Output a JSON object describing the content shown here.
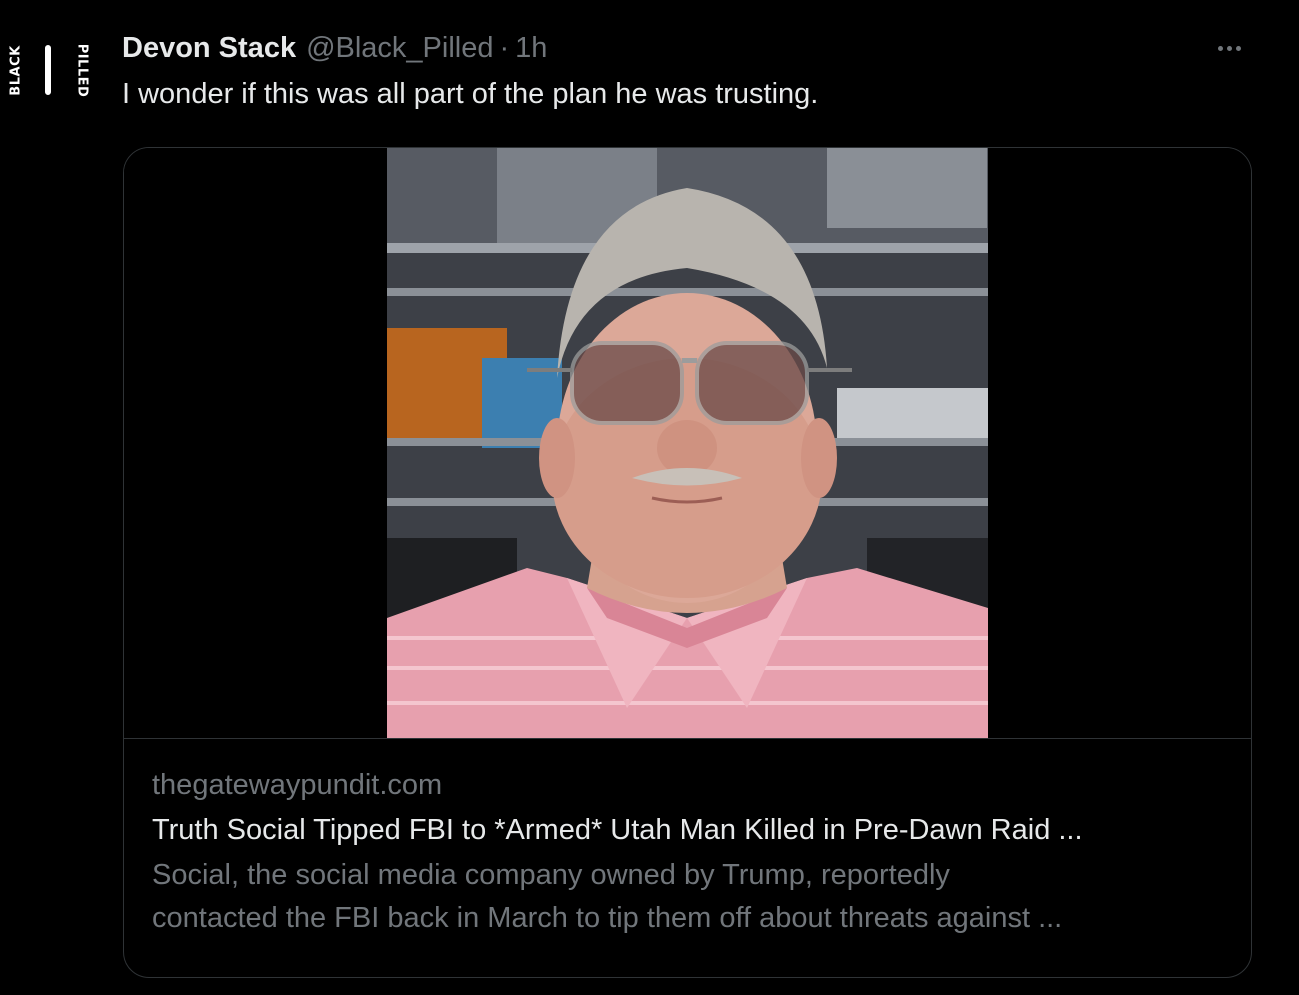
{
  "avatar": {
    "word_left": "BLACK",
    "word_right": "PILLED"
  },
  "author": {
    "display_name": "Devon Stack",
    "handle": "@Black_Pilled",
    "separator": "·",
    "time": "1h"
  },
  "tweet": {
    "text": "I wonder if this was all part of the plan he was trusting."
  },
  "link_card": {
    "domain": "thegatewaypundit.com",
    "title": "Truth Social Tipped FBI to *Armed* Utah Man Killed in Pre-Dawn Raid ...",
    "description_line1": "Social, the social media company owned by Trump, reportedly",
    "description_line2": "contacted the FBI back in March to tip them off about threats against ..."
  },
  "icons": {
    "more": "more-horizontal-icon"
  },
  "colors": {
    "background": "#000000",
    "primary_text": "#e7e9ea",
    "secondary_text": "#71767b",
    "border": "#2f3336"
  }
}
